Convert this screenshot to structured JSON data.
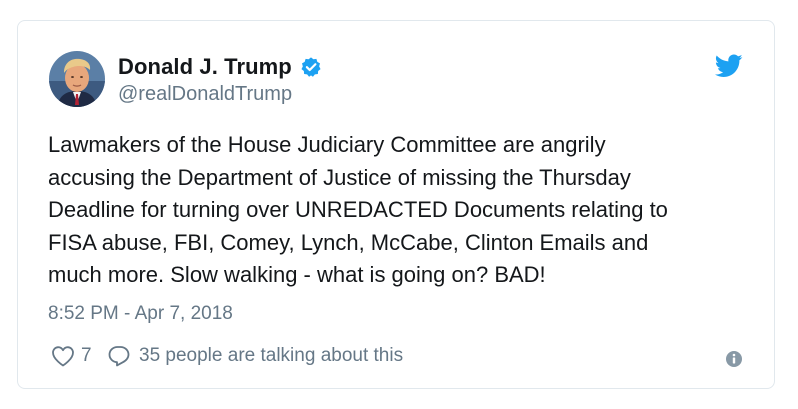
{
  "tweet": {
    "display_name": "Donald J. Trump",
    "handle": "@realDonaldTrump",
    "verified": true,
    "text_lines": [
      "Lawmakers of the House Judiciary Committee are angrily",
      "accusing the Department of Justice of missing the Thursday",
      "Deadline for turning over UNREDACTED Documents relating to",
      "FISA abuse, FBI, Comey, Lynch, McCabe, Clinton Emails and",
      "much more. Slow walking - what is going on? BAD!"
    ],
    "timestamp": "8:52 PM - Apr 7, 2018",
    "likes": "7",
    "talking": "35 people are talking about this"
  },
  "icons": {
    "avatar": "profile-photo",
    "verified": "verified-badge-icon",
    "brand": "twitter-bird-icon",
    "like": "heart-icon",
    "reply": "speech-bubble-icon",
    "info": "info-icon"
  },
  "colors": {
    "brand_blue": "#1da1f2",
    "text_primary": "#14171a",
    "text_secondary": "#657786",
    "border": "#e1e8ed"
  }
}
